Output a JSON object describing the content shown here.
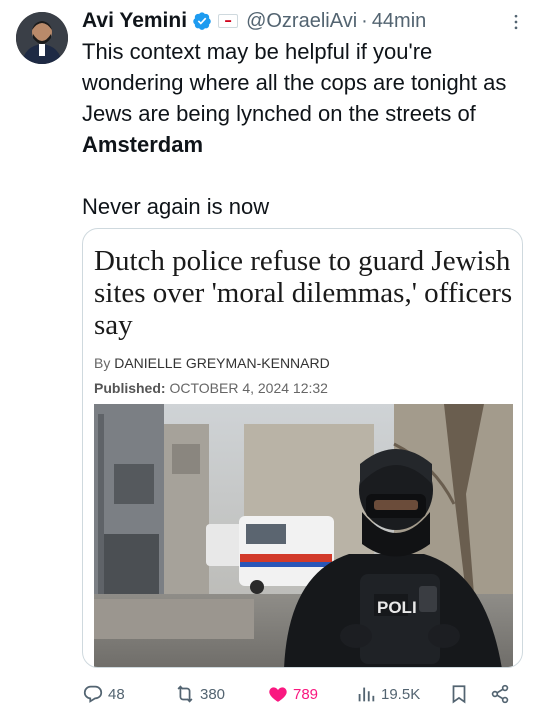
{
  "author": {
    "display_name": "Avi Yemini",
    "handle": "@OzraeliAvi",
    "separator": "·",
    "time": "44min",
    "verified_icon": "verified-badge-icon",
    "affiliation_icon": "affiliate-flag-icon"
  },
  "tweet": {
    "line1_plain": "This context may be helpful if you're wondering where all the cops are tonight as Jews are being lynched on the streets of ",
    "line1_bold": "Amsterdam",
    "line2": "Never again is now"
  },
  "card": {
    "headline": "Dutch police refuse to guard Jewish sites over 'moral dilemmas,' officers say",
    "byline_prefix": "By",
    "byline_author": "DANIELLE GREYMAN-KENNARD",
    "published_label": "Published:",
    "published_value": "OCTOBER 4, 2024 12:32",
    "photo_text": "POLI"
  },
  "actions": {
    "replies": "48",
    "retweets": "380",
    "likes": "789",
    "views": "19.5K"
  },
  "colors": {
    "accent_blue": "#1d9bf0",
    "like_pink": "#f91880",
    "muted": "#536471"
  }
}
